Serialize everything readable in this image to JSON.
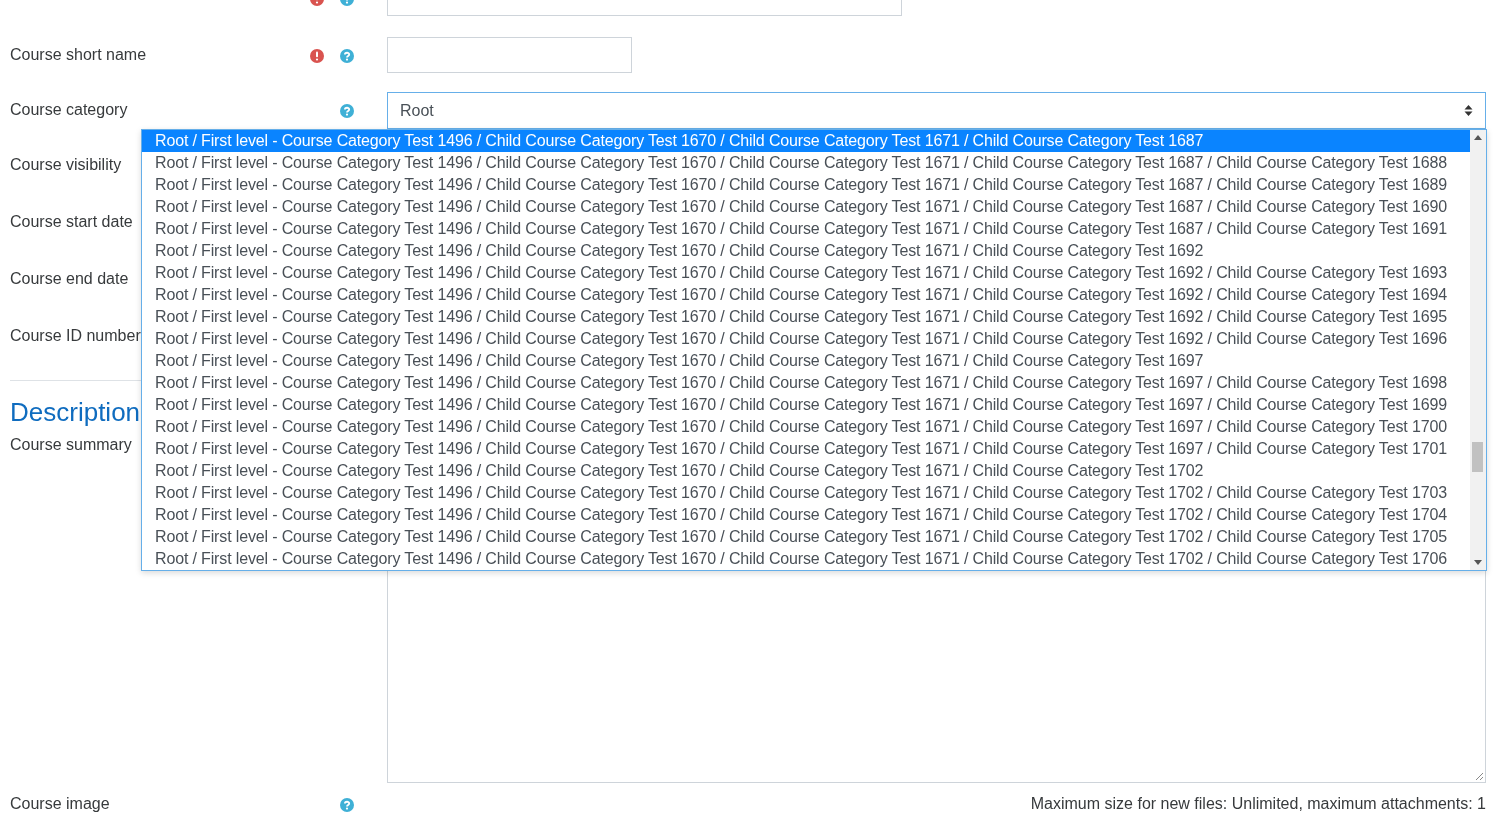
{
  "general_fields": [
    {
      "kind": "input",
      "required": true,
      "help": true
    },
    {
      "kind": "input",
      "label": "Course short name",
      "required": true,
      "help": true
    },
    {
      "kind": "select",
      "label": "Course category",
      "help": true,
      "value": "Root"
    },
    {
      "kind": "covered",
      "label": "Course visibility"
    },
    {
      "kind": "covered",
      "label": "Course start date"
    },
    {
      "kind": "covered",
      "label": "Course end date"
    },
    {
      "kind": "covered",
      "label": "Course ID number"
    }
  ],
  "description_section": {
    "title": "Description",
    "fields": [
      {
        "kind": "editor",
        "label": "Course summary"
      },
      {
        "kind": "filepicker",
        "label": "Course image",
        "help": true,
        "note": "Maximum size for new files: Unlimited, maximum attachments: 1"
      }
    ]
  },
  "category_dropdown": {
    "options": [
      {
        "label": "Root / First level - Course Category Test 1496 / Child Course Category Test 1670 / Child Course Category Test 1671 / Child Course Category Test 1687",
        "selected": true
      },
      {
        "label": "Root / First level - Course Category Test 1496 / Child Course Category Test 1670 / Child Course Category Test 1671 / Child Course Category Test 1687 / Child Course Category Test 1688",
        "selected": false
      },
      {
        "label": "Root / First level - Course Category Test 1496 / Child Course Category Test 1670 / Child Course Category Test 1671 / Child Course Category Test 1687 / Child Course Category Test 1689",
        "selected": false
      },
      {
        "label": "Root / First level - Course Category Test 1496 / Child Course Category Test 1670 / Child Course Category Test 1671 / Child Course Category Test 1687 / Child Course Category Test 1690",
        "selected": false
      },
      {
        "label": "Root / First level - Course Category Test 1496 / Child Course Category Test 1670 / Child Course Category Test 1671 / Child Course Category Test 1687 / Child Course Category Test 1691",
        "selected": false
      },
      {
        "label": "Root / First level - Course Category Test 1496 / Child Course Category Test 1670 / Child Course Category Test 1671 / Child Course Category Test 1692",
        "selected": false
      },
      {
        "label": "Root / First level - Course Category Test 1496 / Child Course Category Test 1670 / Child Course Category Test 1671 / Child Course Category Test 1692 / Child Course Category Test 1693",
        "selected": false
      },
      {
        "label": "Root / First level - Course Category Test 1496 / Child Course Category Test 1670 / Child Course Category Test 1671 / Child Course Category Test 1692 / Child Course Category Test 1694",
        "selected": false
      },
      {
        "label": "Root / First level - Course Category Test 1496 / Child Course Category Test 1670 / Child Course Category Test 1671 / Child Course Category Test 1692 / Child Course Category Test 1695",
        "selected": false
      },
      {
        "label": "Root / First level - Course Category Test 1496 / Child Course Category Test 1670 / Child Course Category Test 1671 / Child Course Category Test 1692 / Child Course Category Test 1696",
        "selected": false
      },
      {
        "label": "Root / First level - Course Category Test 1496 / Child Course Category Test 1670 / Child Course Category Test 1671 / Child Course Category Test 1697",
        "selected": false
      },
      {
        "label": "Root / First level - Course Category Test 1496 / Child Course Category Test 1670 / Child Course Category Test 1671 / Child Course Category Test 1697 / Child Course Category Test 1698",
        "selected": false
      },
      {
        "label": "Root / First level - Course Category Test 1496 / Child Course Category Test 1670 / Child Course Category Test 1671 / Child Course Category Test 1697 / Child Course Category Test 1699",
        "selected": false
      },
      {
        "label": "Root / First level - Course Category Test 1496 / Child Course Category Test 1670 / Child Course Category Test 1671 / Child Course Category Test 1697 / Child Course Category Test 1700",
        "selected": false
      },
      {
        "label": "Root / First level - Course Category Test 1496 / Child Course Category Test 1670 / Child Course Category Test 1671 / Child Course Category Test 1697 / Child Course Category Test 1701",
        "selected": false
      },
      {
        "label": "Root / First level - Course Category Test 1496 / Child Course Category Test 1670 / Child Course Category Test 1671 / Child Course Category Test 1702",
        "selected": false
      },
      {
        "label": "Root / First level - Course Category Test 1496 / Child Course Category Test 1670 / Child Course Category Test 1671 / Child Course Category Test 1702 / Child Course Category Test 1703",
        "selected": false
      },
      {
        "label": "Root / First level - Course Category Test 1496 / Child Course Category Test 1670 / Child Course Category Test 1671 / Child Course Category Test 1702 / Child Course Category Test 1704",
        "selected": false
      },
      {
        "label": "Root / First level - Course Category Test 1496 / Child Course Category Test 1670 / Child Course Category Test 1671 / Child Course Category Test 1702 / Child Course Category Test 1705",
        "selected": false
      },
      {
        "label": "Root / First level - Course Category Test 1496 / Child Course Category Test 1670 / Child Course Category Test 1671 / Child Course Category Test 1702 / Child Course Category Test 1706",
        "selected": false
      }
    ]
  }
}
